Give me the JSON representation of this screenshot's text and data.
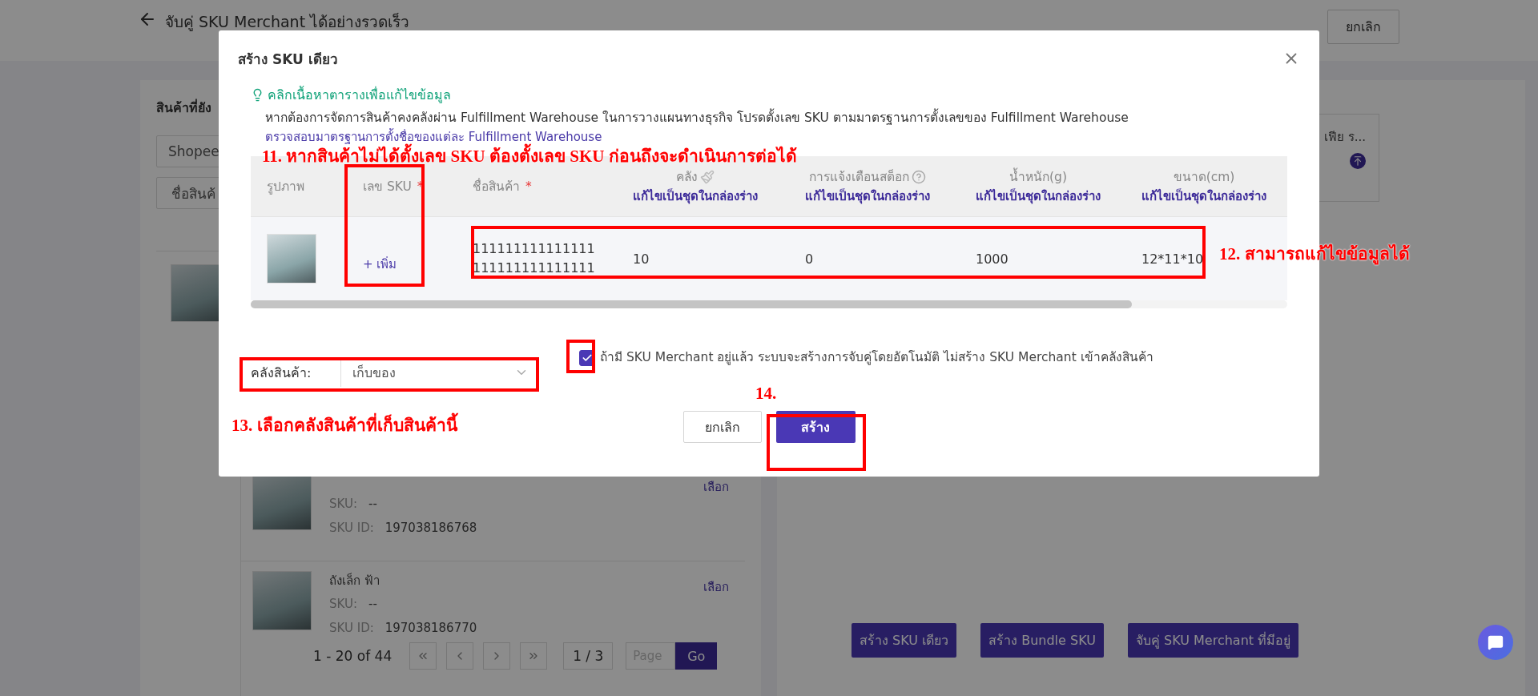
{
  "header": {
    "title": "จับคู่ SKU Merchant ได้อย่างรวดเร็ว",
    "cancel_button": "ยกเลิก"
  },
  "left_panel": {
    "heading": "สินค้าที่ยัง",
    "platform_select": "Shopee",
    "search_field": "ชื่อสินค้",
    "products": [
      {
        "kind": "covered"
      },
      {
        "kind": "listing",
        "sku_label": "SKU:",
        "sku": "--",
        "sku_id_label": "SKU ID:",
        "sku_id": "197038186768",
        "action": "เลือก"
      },
      {
        "kind": "listing",
        "name": "ถังเล็ก ฟ้า",
        "sku_label": "SKU:",
        "sku": "--",
        "sku_id_label": "SKU ID:",
        "sku_id": "197038186770",
        "action": "เลือก"
      }
    ],
    "pagination": {
      "range": "1 - 20 of 44",
      "page": "1 / 3",
      "page_placeholder": "Page",
      "go": "Go"
    }
  },
  "right_panel": {
    "card_text": "เฟีย ร...",
    "buttons": [
      "สร้าง SKU เดียว",
      "สร้าง Bundle SKU",
      "จับคู่ SKU Merchant ที่มีอยู่"
    ]
  },
  "modal": {
    "title": "สร้าง SKU เดียว",
    "hint": "คลิกเนื้อหาตารางเพื่อแก้ไขข้อมูล",
    "notice": "หากต้องการจัดการสินค้าคงคลังผ่าน Fulfillment Warehouse ในการวางแผนทางธุรกิจ โปรดตั้งเลข SKU ตามมาตรฐานการตั้งเลขของ Fulfillment Warehouse",
    "notice_link": "ตรวจสอบมาตรฐานการตั้งชื่อของแต่ละ Fulfillment Warehouse",
    "table": {
      "columns": [
        {
          "kind": "plain",
          "label": "รูปภาพ"
        },
        {
          "kind": "plain",
          "label": "เลข SKU",
          "required_mark": "*"
        },
        {
          "kind": "plain",
          "label": "ชื่อสินค้า",
          "required_mark": "*"
        },
        {
          "kind": "fill",
          "label": "คลัง",
          "sub": "แก้ไขเป็นชุดในกล่องร่าง"
        },
        {
          "kind": "help",
          "label": "การแจ้งเตือนสต็อก",
          "sub": "แก้ไขเป็นชุดในกล่องร่าง"
        },
        {
          "kind": "batch",
          "label": "น้ำหนัก(g)",
          "sub": "แก้ไขเป็นชุดในกล่องร่าง"
        },
        {
          "kind": "batch",
          "label": "ขนาด(cm)",
          "sub": "แก้ไขเป็นชุดในกล่องร่าง"
        }
      ],
      "rows": [
        {
          "sku_action": "+ เพิ่ม",
          "name": "111111111111111111111111111111",
          "stock": "10",
          "alert": "0",
          "weight": "1000",
          "size": "12*11*10"
        }
      ]
    },
    "warehouse_label": "คลังสินค้า:",
    "warehouse_value": "เก็บของ",
    "auto_match": {
      "checked": true,
      "text": "ถ้ามี SKU Merchant อยู่แล้ว ระบบจะสร้างการจับคู่โดยอัตโนมัติ ไม่สร้าง SKU Merchant เข้าคลังสินค้า"
    },
    "buttons": {
      "cancel": "ยกเลิก",
      "create": "สร้าง"
    }
  },
  "annotations": [
    "11. หากสินค้าไม่ได้ตั้งเลข SKU ต้องตั้งเลข SKU ก่อนถึงจะดำเนินการต่อได้",
    "12. สามารถแก้ไขข้อมูลได้",
    "13. เลือกคลังสินค้าที่เก็บสินค้านี้",
    "14."
  ]
}
